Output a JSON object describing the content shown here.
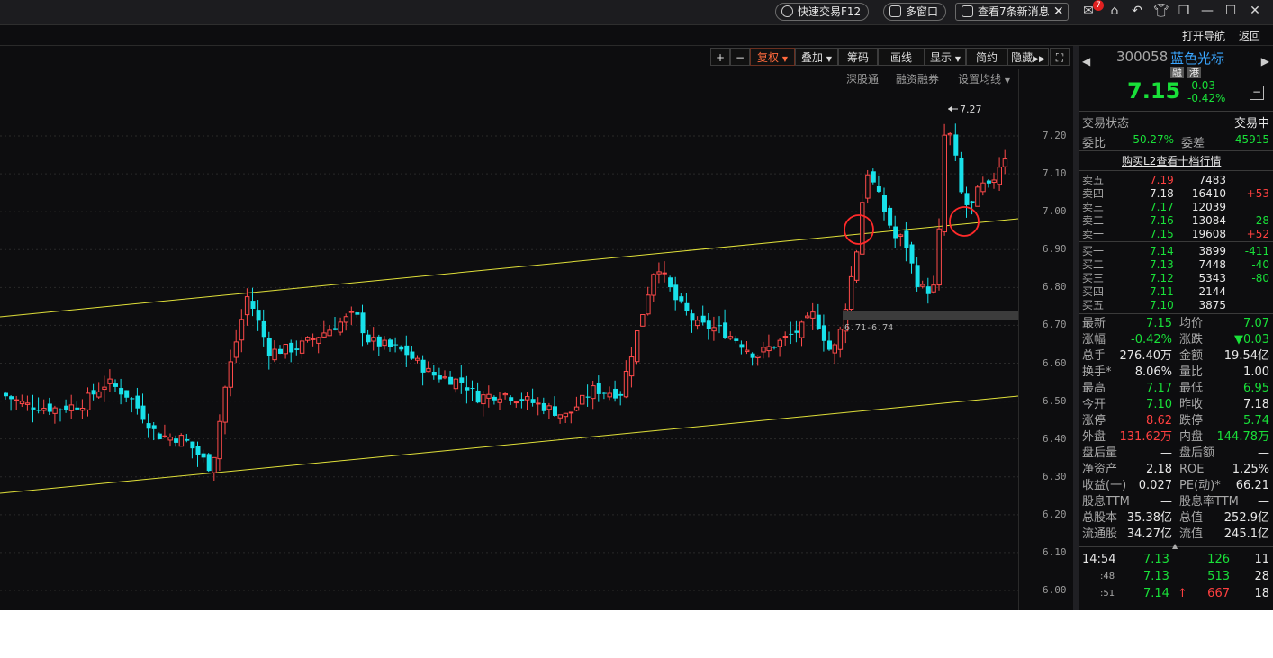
{
  "topbar": {
    "quick_trade": "快速交易F12",
    "multi_window": "多窗口",
    "messages": "查看7条新消息",
    "badge": "7"
  },
  "nav": {
    "open_nav": "打开导航",
    "back": "返回"
  },
  "chart_toolbar": {
    "plus": "+",
    "minus": "−",
    "fuquan": "复权",
    "overlay": "叠加",
    "chips": "筹码",
    "draw": "画线",
    "display": "显示",
    "brief": "简约",
    "hide": "隐藏",
    "fullscreen": "⛶"
  },
  "chart_links": {
    "shengu": "深股通",
    "margin": "融资融券",
    "ma_settings": "设置均线"
  },
  "chart_data": {
    "type": "candlestick",
    "y_ticks": [
      "7.20",
      "7.10",
      "7.00",
      "6.90",
      "6.80",
      "6.70",
      "6.60",
      "6.50",
      "6.40",
      "6.30",
      "6.20",
      "6.10",
      "6.00"
    ],
    "ylim": [
      5.98,
      7.29
    ],
    "high_annotation": "7.27",
    "box_label": "6.71-6.74",
    "colors": {
      "up": "#ff4a4a",
      "down": "#18e1ea",
      "trend": "#e0e03a",
      "circle": "#ff2a2a",
      "box": "#3c3c3c"
    }
  },
  "quote": {
    "code": "300058",
    "name": "蓝色光标",
    "tag1": "融",
    "tag2": "港",
    "price": "7.15",
    "change": "-0.03",
    "change_pct": "-0.42%",
    "status_label": "交易状态",
    "status_value": "交易中",
    "weibi_label": "委比",
    "weibi_value": "-50.27%",
    "weicha_label": "委差",
    "weicha_value": "-45915",
    "l2_link": "购买L2查看十档行情"
  },
  "orderbook": {
    "asks": [
      {
        "label": "卖五",
        "price": "7.19",
        "vol": "7483",
        "chg": ""
      },
      {
        "label": "卖四",
        "price": "7.18",
        "vol": "16410",
        "chg": "+53"
      },
      {
        "label": "卖三",
        "price": "7.17",
        "vol": "12039",
        "chg": ""
      },
      {
        "label": "卖二",
        "price": "7.16",
        "vol": "13084",
        "chg": "-28"
      },
      {
        "label": "卖一",
        "price": "7.15",
        "vol": "19608",
        "chg": "+52"
      }
    ],
    "bids": [
      {
        "label": "买一",
        "price": "7.14",
        "vol": "3899",
        "chg": "-411"
      },
      {
        "label": "买二",
        "price": "7.13",
        "vol": "7448",
        "chg": "-40"
      },
      {
        "label": "买三",
        "price": "7.12",
        "vol": "5343",
        "chg": "-80"
      },
      {
        "label": "买四",
        "price": "7.11",
        "vol": "2144",
        "chg": ""
      },
      {
        "label": "买五",
        "price": "7.10",
        "vol": "3875",
        "chg": ""
      }
    ]
  },
  "stats": [
    {
      "l1": "最新",
      "v1": "7.15",
      "l2": "均价",
      "v2": "7.07"
    },
    {
      "l1": "涨幅",
      "v1": "-0.42%",
      "l2": "涨跌",
      "v2": "▼0.03"
    },
    {
      "l1": "总手",
      "v1": "276.40万",
      "l2": "金额",
      "v2": "19.54亿"
    },
    {
      "l1": "换手*",
      "v1": "8.06%",
      "l2": "量比",
      "v2": "1.00"
    },
    {
      "l1": "最高",
      "v1": "7.17",
      "l2": "最低",
      "v2": "6.95"
    },
    {
      "l1": "今开",
      "v1": "7.10",
      "l2": "昨收",
      "v2": "7.18"
    },
    {
      "l1": "涨停",
      "v1": "8.62",
      "l2": "跌停",
      "v2": "5.74"
    },
    {
      "l1": "外盘",
      "v1": "131.62万",
      "l2": "内盘",
      "v2": "144.78万"
    },
    {
      "l1": "盘后量",
      "v1": "—",
      "l2": "盘后额",
      "v2": "—"
    },
    {
      "l1": "净资产",
      "v1": "2.18",
      "l2": "ROE",
      "v2": "1.25%"
    },
    {
      "l1": "收益(一)",
      "v1": "0.027",
      "l2": "PE(动)*",
      "v2": "66.21"
    },
    {
      "l1": "股息TTM",
      "v1": "—",
      "l2": "股息率TTM",
      "v2": "—"
    },
    {
      "l1": "总股本",
      "v1": "35.38亿",
      "l2": "总值",
      "v2": "252.9亿"
    },
    {
      "l1": "流通股",
      "v1": "34.27亿",
      "l2": "流值",
      "v2": "245.1亿"
    }
  ],
  "ticks": [
    {
      "time": "14:54",
      "price": "7.13",
      "vol": "126",
      "num": "11"
    },
    {
      "time": ":48",
      "price": "7.13",
      "vol": "513",
      "num": "28"
    },
    {
      "time": ":51",
      "price": "7.14",
      "vol": "667",
      "num": "18"
    }
  ]
}
